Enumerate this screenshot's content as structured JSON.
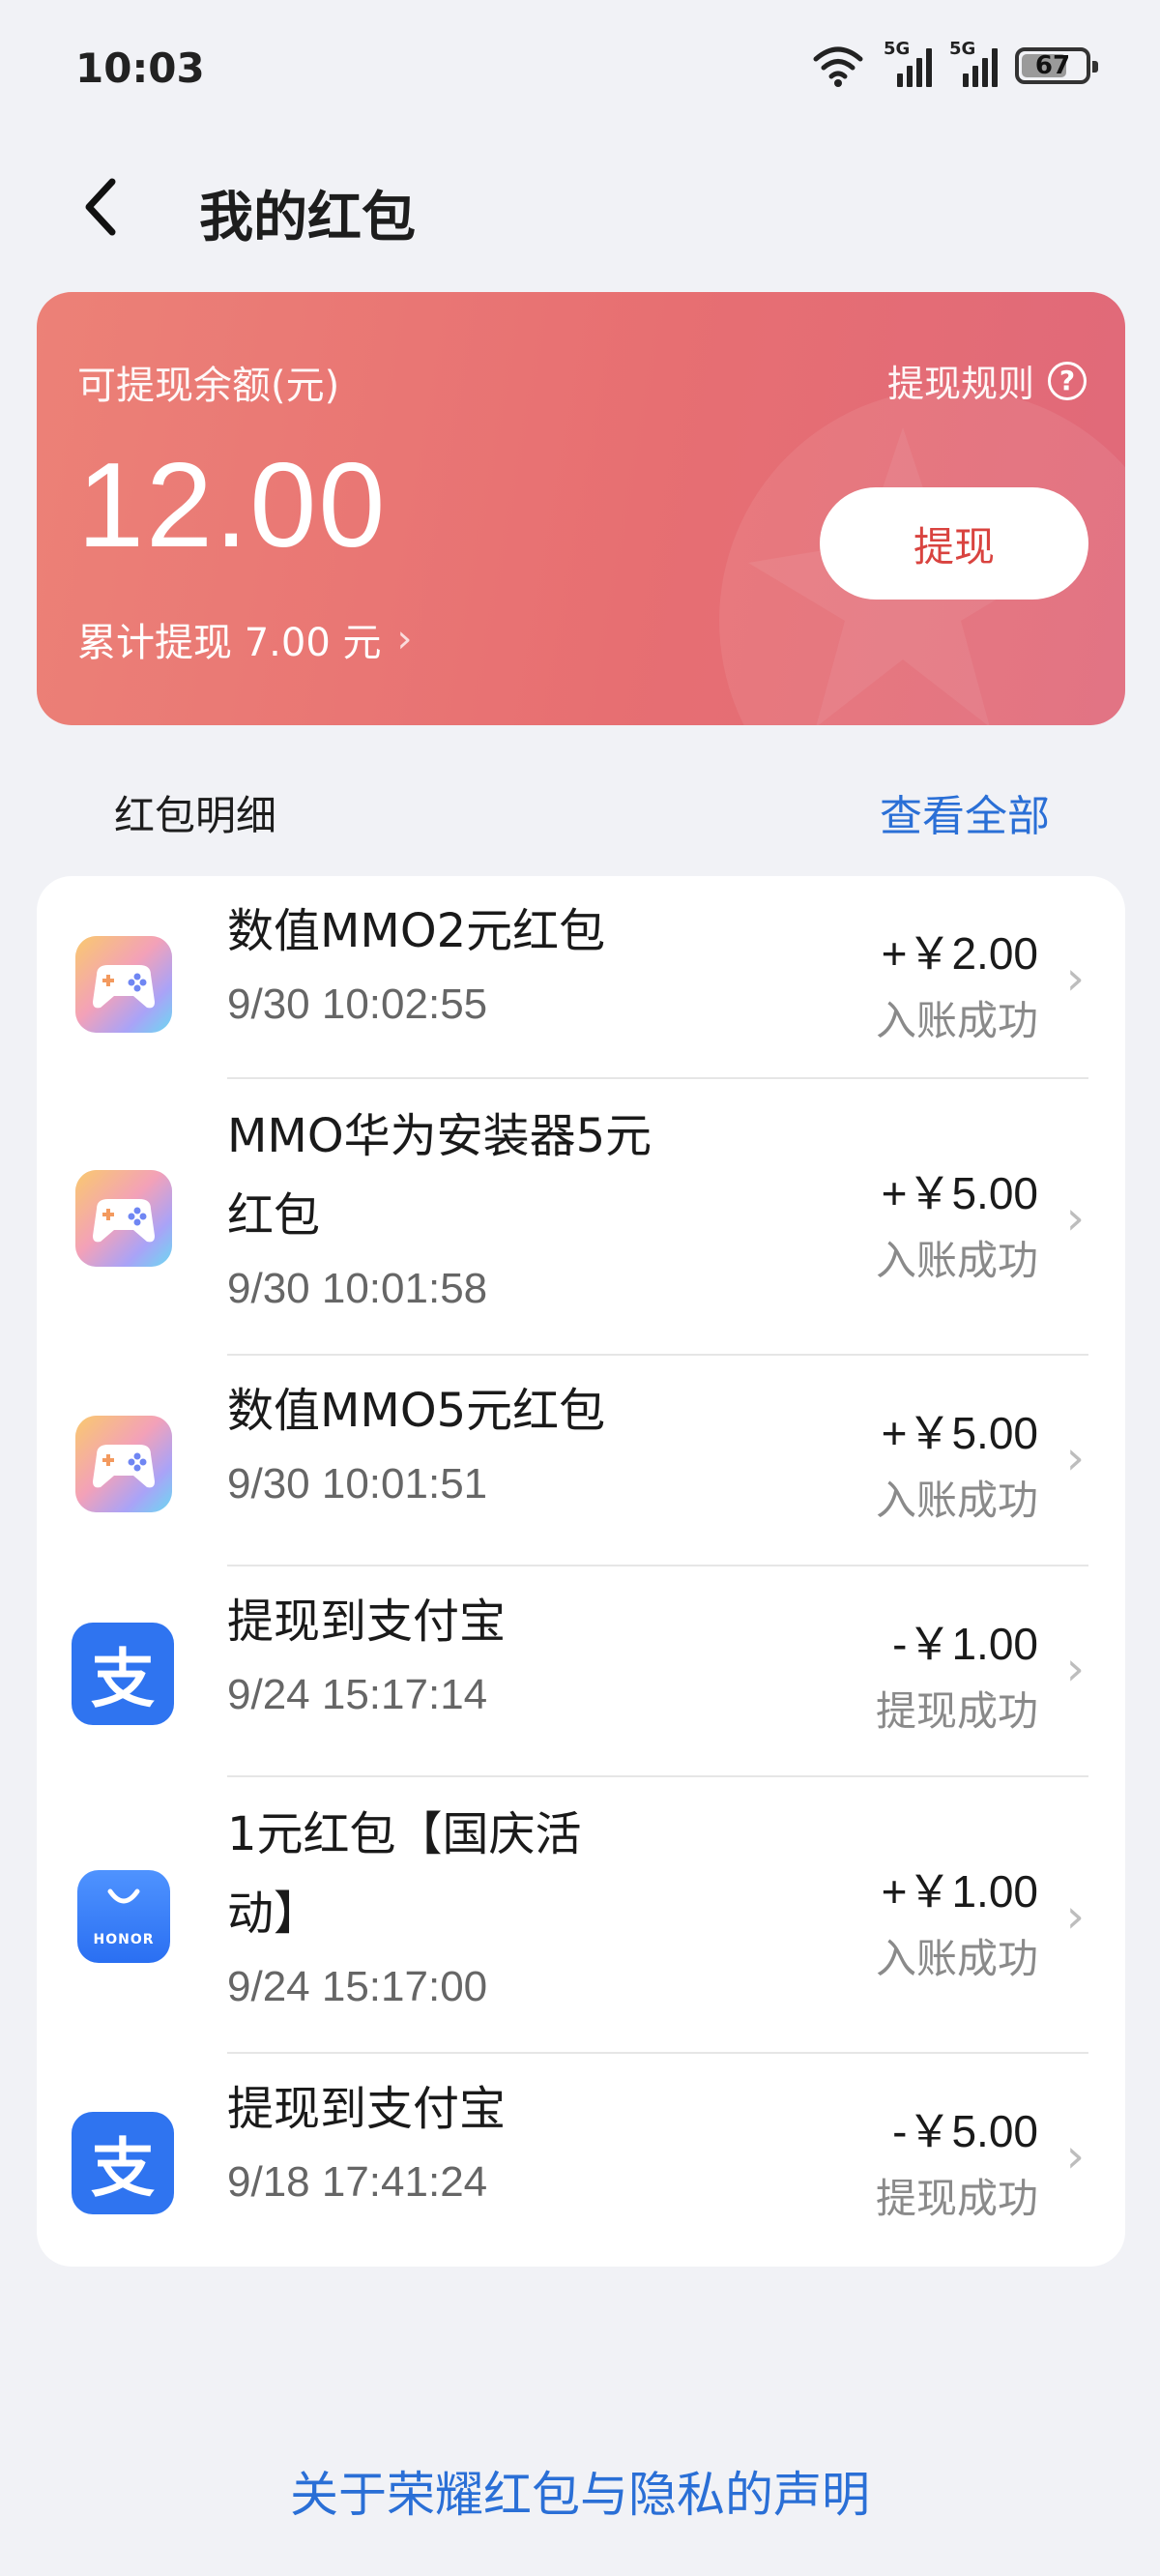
{
  "status_bar": {
    "time": "10:03",
    "signal1_label": "5G",
    "signal2_label": "5G",
    "battery": "67"
  },
  "header": {
    "title": "我的红包"
  },
  "balance_card": {
    "label": "可提现余额(元)",
    "rules_label": "提现规则",
    "amount": "12.00",
    "withdraw_button": "提现",
    "total_withdrawn": "累计提现 7.00 元"
  },
  "section": {
    "title": "红包明细",
    "view_all": "查看全部"
  },
  "transactions": [
    {
      "icon": "game-controller-icon",
      "name": "数值MMO2元红包",
      "time": "9/30 10:02:55",
      "amount": "+￥2.00",
      "status": "入账成功"
    },
    {
      "icon": "game-controller-icon",
      "name_line1": "MMO华为安装器5元",
      "name_line2": "红包",
      "time": "9/30 10:01:58",
      "amount": "+￥5.00",
      "status": "入账成功"
    },
    {
      "icon": "game-controller-icon",
      "name": "数值MMO5元红包",
      "time": "9/30 10:01:51",
      "amount": "+￥5.00",
      "status": "入账成功"
    },
    {
      "icon": "alipay-icon",
      "name": "提现到支付宝",
      "time": "9/24 15:17:14",
      "amount": "-￥1.00",
      "status": "提现成功"
    },
    {
      "icon": "honor-icon",
      "name_line1": "1元红包【国庆活",
      "name_line2": "动】",
      "time": "9/24 15:17:00",
      "amount": "+￥1.00",
      "status": "入账成功"
    },
    {
      "icon": "alipay-icon",
      "name": "提现到支付宝",
      "time": "9/18 17:41:24",
      "amount": "-￥5.00",
      "status": "提现成功"
    }
  ],
  "honor_icon_text": "HONOR",
  "alipay_icon_glyph": "支",
  "footer": {
    "link": "关于荣耀红包与隐私的声明"
  },
  "colors": {
    "card_gradient_start": "#ec8177",
    "card_gradient_end": "#e0697a",
    "link_blue": "#2a6fd6",
    "withdraw_text": "#d9433f",
    "alipay_blue": "#2f74f0"
  }
}
